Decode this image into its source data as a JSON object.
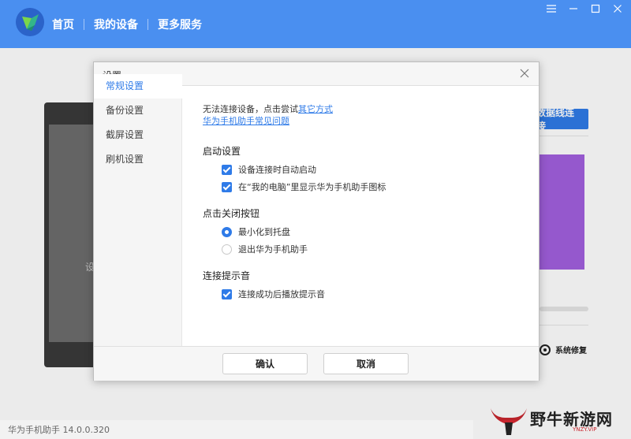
{
  "header": {
    "nav": [
      {
        "label": "首页"
      },
      {
        "label": "我的设备"
      },
      {
        "label": "更多服务"
      }
    ]
  },
  "background": {
    "phone_text": "设",
    "usb_button": "数据线连接",
    "repair_label": "系统修复"
  },
  "dialog": {
    "title": "设置",
    "sidebar": [
      {
        "label": "常规设置",
        "active": true
      },
      {
        "label": "备份设置"
      },
      {
        "label": "截屏设置"
      },
      {
        "label": "刷机设置"
      }
    ],
    "tip_text": "无法连接设备，点击尝试",
    "tip_link": "其它方式",
    "faq_link": "华为手机助手常见问题",
    "sections": {
      "startup": {
        "title": "启动设置",
        "options": [
          "设备连接时自动启动",
          "在“我的电脑”里显示华为手机助手图标"
        ]
      },
      "close": {
        "title": "点击关闭按钮",
        "options": [
          "最小化到托盘",
          "退出华为手机助手"
        ]
      },
      "sound": {
        "title": "连接提示音",
        "options": [
          "连接成功后播放提示音"
        ]
      }
    },
    "confirm_label": "确认",
    "cancel_label": "取消"
  },
  "statusbar": {
    "text": "华为手机助手 14.0.0.320"
  },
  "watermark": {
    "title": "野牛新游网",
    "sub": "YNZY.VIP"
  },
  "colors": {
    "header": "#4a8ff0",
    "accent": "#2f7be8",
    "purple": "#a260df"
  }
}
